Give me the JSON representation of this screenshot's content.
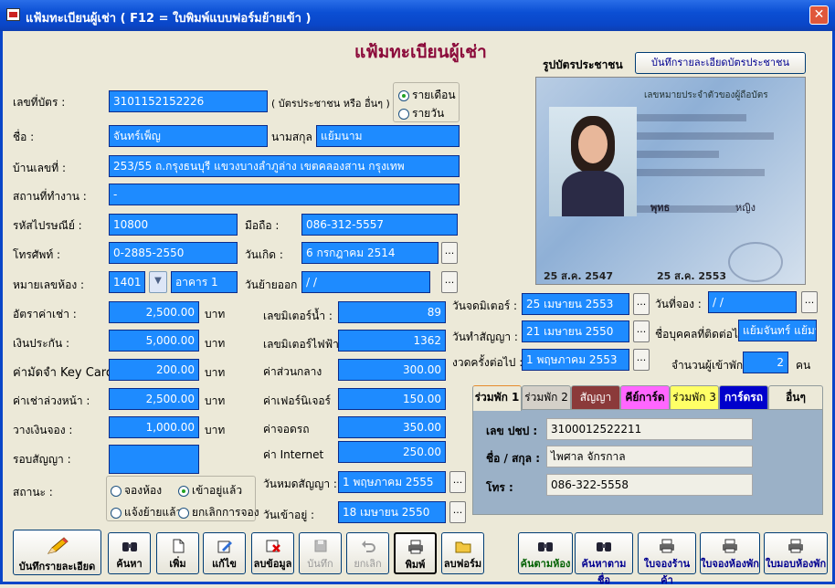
{
  "window": {
    "title": "แฟ้มทะเบียนผู้เช่า ( F12 = ใบพิมพ์แบบฟอร์มย้ายเข้า )",
    "close": "✕"
  },
  "heading": "แฟ้มทะเบียนผู้เช่า",
  "idcard": {
    "label": "รูปบัตรประชาชน",
    "button": "บันทึกรายละเอียดบัตรประชาชน",
    "card_header": "เลขหมายประจำตัวของผู้ถือบัตร",
    "card_name_text": "พุทธ",
    "card_name2": "หญิง",
    "card_date1": "25 ส.ค. 2547",
    "card_date2": "25 ส.ค. 2553"
  },
  "form": {
    "card_no": {
      "label": "เลขที่บัตร :",
      "value": "3101152152226",
      "note": "( บัตรประชาชน หรือ อื่นๆ )"
    },
    "rent_type": {
      "monthly": "รายเดือน",
      "daily": "รายวัน",
      "selected": "monthly"
    },
    "name": {
      "label": "ชื่อ :",
      "value": "จันทร์เพ็ญ"
    },
    "surname": {
      "label": "นามสกุล :",
      "value": "แย้มนาม"
    },
    "address": {
      "label": "บ้านเลขที่ :",
      "value": "253/55 ถ.กรุงธนบุรี แขวงบางลำภูล่าง เขตคลองสาน กรุงเทพ"
    },
    "workplace": {
      "label": "สถานที่ทำงาน :",
      "value": "-"
    },
    "zip": {
      "label": "รหัสไปรษณีย์ :",
      "value": "10800"
    },
    "mobile": {
      "label": "มือถือ :",
      "value": "086-312-5557"
    },
    "phone": {
      "label": "โทรศัพท์ :",
      "value": "0-2885-2550"
    },
    "birthday": {
      "label": "วันเกิด :",
      "value": "6 กรกฎาคม 2514"
    },
    "room": {
      "label": "หมายเลขห้อง :",
      "value": "1401",
      "building": "อาคาร 1"
    },
    "moveout": {
      "label": "วันย้ายออก :",
      "value": " /  /"
    },
    "rent": {
      "label": "อัตราค่าเช่า :",
      "value": "2,500.00",
      "unit": "บาท"
    },
    "deposit": {
      "label": "เงินประกัน :",
      "value": "5,000.00",
      "unit": "บาท"
    },
    "keycard": {
      "label": "ค่ามัดจำ Key Card",
      "value": "200.00",
      "unit": "บาท"
    },
    "advance": {
      "label": "ค่าเช่าล่วงหน้า :",
      "value": "2,500.00",
      "unit": "บาท"
    },
    "reserve": {
      "label": "วางเงินจอง :",
      "value": "1,000.00",
      "unit": "บาท"
    },
    "contract_round": {
      "label": "รอบสัญญา :",
      "value": ""
    },
    "status": {
      "label": "สถานะ :",
      "reserve": "จองห้อง",
      "movedin": "เข้าอยู่แล้ว",
      "notified": "แจ้งย้ายแล้ว",
      "cancel": "ยกเลิกการจอง",
      "selected": "movedin"
    },
    "water": {
      "label": "เลขมิเตอร์น้ำ :",
      "value": "89"
    },
    "electric": {
      "label": "เลขมิเตอร์ไฟฟ้า :",
      "value": "1362"
    },
    "common": {
      "label": "ค่าส่วนกลาง",
      "value": "300.00"
    },
    "furniture": {
      "label": "ค่าเฟอร์นิเจอร์",
      "value": "150.00"
    },
    "parking": {
      "label": "ค่าจอดรถ",
      "value": "350.00"
    },
    "internet": {
      "label": "ค่า Internet",
      "value": "250.00"
    },
    "contract_end": {
      "label": "วันหมดสัญญา :",
      "value": "1 พฤษภาคม 2555"
    },
    "movein": {
      "label": "วันเข้าอยู่ :",
      "value": "18 เมษายน 2550"
    },
    "meter_date": {
      "label": "วันจดมิเตอร์ :",
      "value": "25 เมษายน 2553"
    },
    "reserve_date": {
      "label": "วันที่จอง :",
      "value": " /  /"
    },
    "contract_date": {
      "label": "วันทำสัญญา :",
      "value": "21 เมษายน 2550"
    },
    "contact": {
      "label": "ชื่อบุคคลที่ติดต่อได้",
      "value": "แย้มจันทร์ แย้มนาม"
    },
    "next_bill": {
      "label": "งวดครั้งต่อไป :",
      "value": "1 พฤษภาคม 2553"
    },
    "occupants": {
      "label": "จำนวนผู้เข้าพัก",
      "value": "2",
      "unit": "คน"
    }
  },
  "tabs": [
    {
      "label": "ร่วมพัก 1",
      "bg": "#ece9d8"
    },
    {
      "label": "ร่วมพัก 2",
      "bg": "#d4d0c8"
    },
    {
      "label": "สัญญา",
      "bg": "#8b3a3a",
      "color": "#fff"
    },
    {
      "label": "คีย์การ์ด",
      "bg": "#ff66ff"
    },
    {
      "label": "ร่วมพัก 3",
      "bg": "#ffff66"
    },
    {
      "label": "การ์ดรถ",
      "bg": "#0000cc",
      "color": "#fff"
    },
    {
      "label": "อื่นๆ",
      "bg": "#ece9d8"
    }
  ],
  "cotenant": {
    "id_label": "เลข ปชป :",
    "id": "3100012522211",
    "name_label": "ชื่อ / สกุล :",
    "name": "ไพศาล จักรกาล",
    "phone_label": "โทร :",
    "phone": "086-322-5558"
  },
  "buttons": {
    "save": "บันทึกรายละเอียด",
    "search": "ค้นหา",
    "add": "เพิ่ม",
    "edit": "แก้ไข",
    "delete": "ลบข้อมูล",
    "record": "บันทึก",
    "cancel": "ยกเลิก",
    "print": "พิมพ์",
    "delform": "ลบฟอร์ม",
    "by_room": "ค้นตามห้อง",
    "by_name": "ค้นหาตามชื่อ",
    "shop_form": "ใบจองร้านค้า",
    "room_form": "ใบจองห้องพัก",
    "handover": "ใบมอบห้องพัก"
  }
}
